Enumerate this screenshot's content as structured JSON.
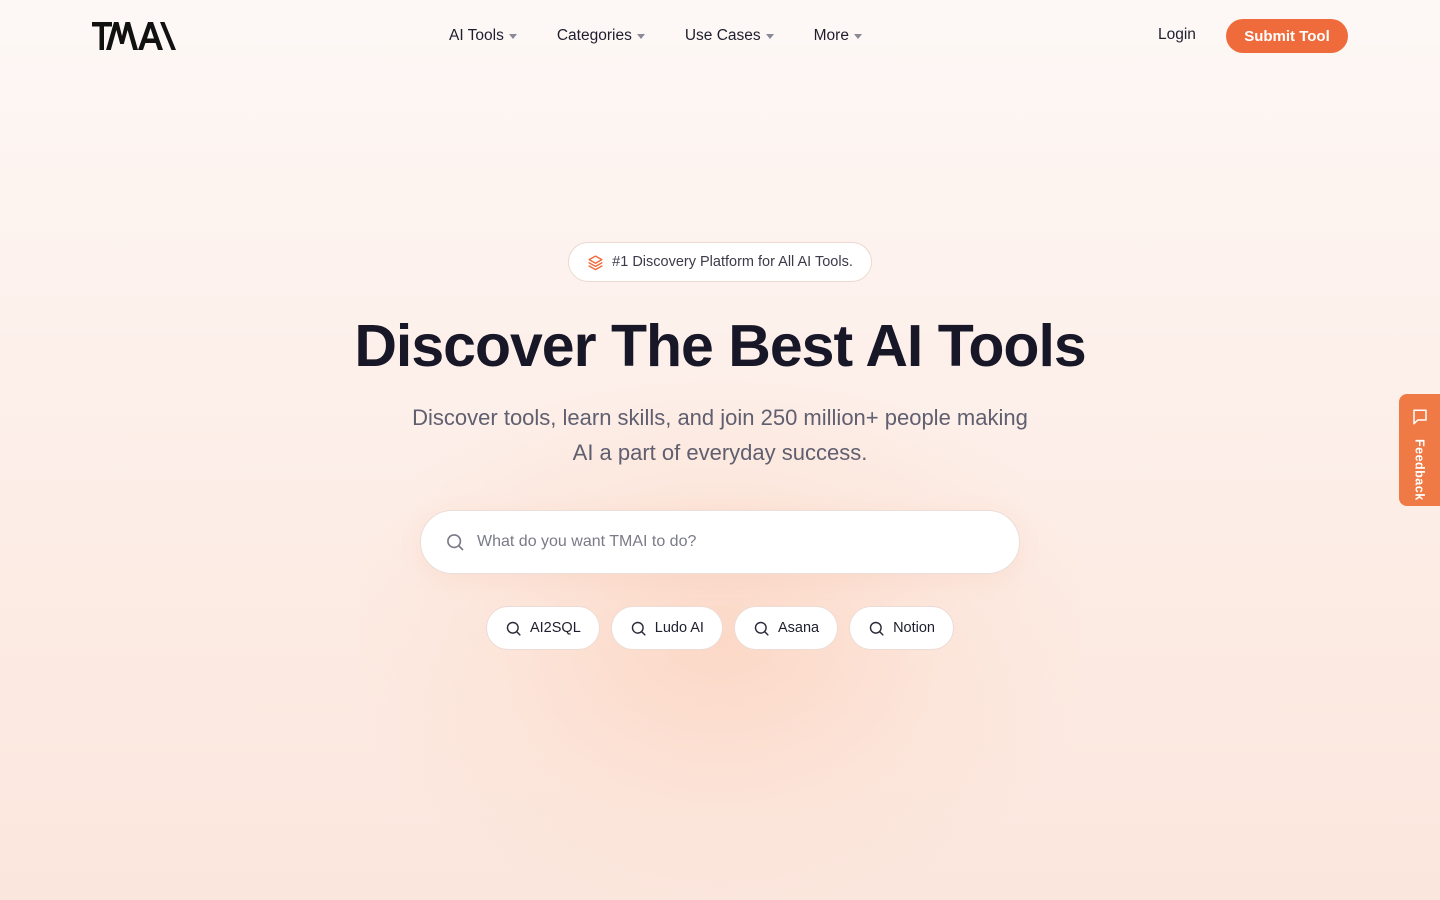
{
  "brand": {
    "logo_text": "TMAI",
    "accent_color": "#f06b3c"
  },
  "nav": {
    "items": [
      {
        "label": "AI Tools",
        "icon": "chevron-down-icon"
      },
      {
        "label": "Categories",
        "icon": "chevron-down-icon"
      },
      {
        "label": "Use Cases",
        "icon": "chevron-down-icon"
      },
      {
        "label": "More",
        "icon": "chevron-down-icon"
      }
    ],
    "login_label": "Login",
    "submit_label": "Submit Tool"
  },
  "hero": {
    "badge_text": "#1 Discovery Platform for All AI Tools.",
    "badge_icon": "layers-icon",
    "title": "Discover The Best AI Tools",
    "subtitle_line1": "Discover tools, learn skills, and join 250 million+ people making",
    "subtitle_line2": "AI a part of everyday success."
  },
  "search": {
    "placeholder": "What do you want TMAI to do?",
    "value": "",
    "icon": "search-icon"
  },
  "suggestions": [
    {
      "label": "AI2SQL",
      "icon": "search-icon"
    },
    {
      "label": "Ludo AI",
      "icon": "search-icon"
    },
    {
      "label": "Asana",
      "icon": "search-icon"
    },
    {
      "label": "Notion",
      "icon": "search-icon"
    }
  ],
  "feedback": {
    "label": "Feedback",
    "icon": "chat-bubble-icon",
    "color": "#f07a45"
  }
}
